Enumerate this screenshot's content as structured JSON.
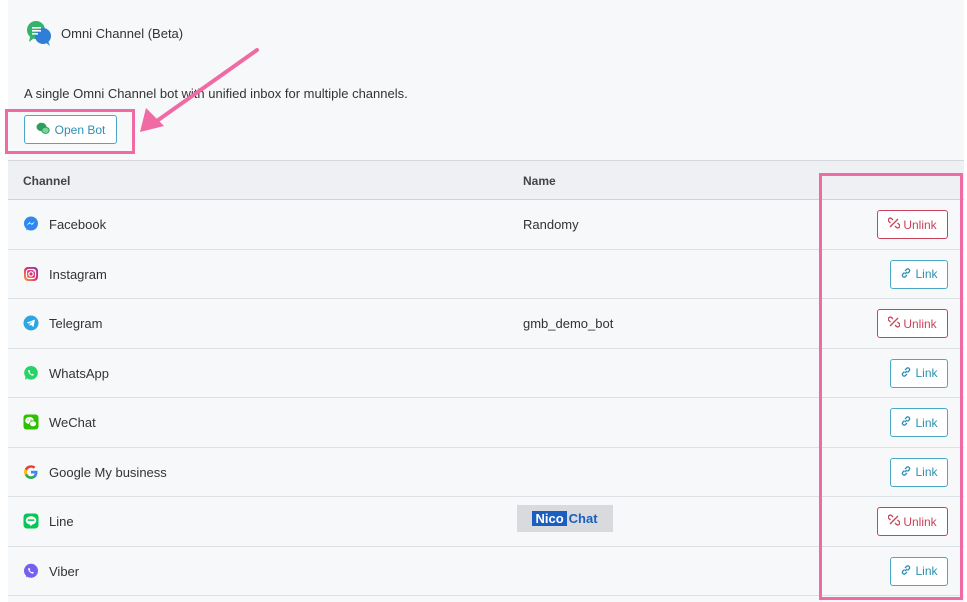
{
  "header": {
    "title": "Omni Channel (Beta)",
    "icon": "chat-bubbles-icon"
  },
  "description": "A single Omni Channel bot with unified inbox for multiple channels.",
  "open_bot": {
    "label": "Open Bot",
    "icon": "chat-bubbles-icon"
  },
  "table": {
    "columns": [
      "Channel",
      "Name"
    ],
    "rows": [
      {
        "channel": "Facebook",
        "name": "Randomy",
        "action": "Unlink",
        "icon": "messenger-icon"
      },
      {
        "channel": "Instagram",
        "name": "",
        "action": "Link",
        "icon": "instagram-icon"
      },
      {
        "channel": "Telegram",
        "name": "gmb_demo_bot",
        "action": "Unlink",
        "icon": "telegram-icon"
      },
      {
        "channel": "WhatsApp",
        "name": "",
        "action": "Link",
        "icon": "whatsapp-icon"
      },
      {
        "channel": "WeChat",
        "name": "",
        "action": "Link",
        "icon": "wechat-icon"
      },
      {
        "channel": "Google My business",
        "name": "",
        "action": "Link",
        "icon": "google-icon"
      },
      {
        "channel": "Line",
        "name": "",
        "action": "Unlink",
        "icon": "line-icon"
      },
      {
        "channel": "Viber",
        "name": "",
        "action": "Link",
        "icon": "viber-icon"
      }
    ]
  },
  "watermark": {
    "part1": "Nico",
    "part2": "Chat"
  },
  "colors": {
    "link": "#2e8fb4",
    "unlink": "#c9435a",
    "highlight": "#f06aa3"
  }
}
